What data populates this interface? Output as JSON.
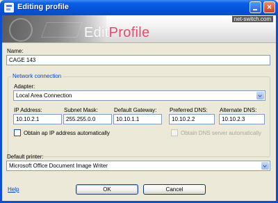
{
  "window": {
    "title": "Editing profile",
    "close_glyph": "×"
  },
  "banner": {
    "title_part1": "Edit",
    "title_part2": "Profile",
    "site": "net-switch.com"
  },
  "form": {
    "name_label": "Name:",
    "name_value": "CAGE 143",
    "network_group_title": "Network connection",
    "adapter_label": "Adapter:",
    "adapter_value": "Local Area Connection",
    "ip_label": "IP Address:",
    "ip_value": "10.10.2.1",
    "mask_label": "Subnet Mask:",
    "mask_value": "255.255.0.0",
    "gateway_label": "Default Gateway:",
    "gateway_value": "10.10.1.1",
    "dns1_label": "Preferred DNS:",
    "dns1_value": "10.10.2.2",
    "dns2_label": "Alternate DNS:",
    "dns2_value": "10.10.2.3",
    "auto_ip_label": "Obtain ap IP address automatically",
    "auto_dns_label": "Obtain DNS server automatically",
    "printer_label": "Default printer:",
    "printer_value": "Microsoft Office Document Image Writer"
  },
  "footer": {
    "help_link": "Help",
    "ok_label": "OK",
    "cancel_label": "Cancel"
  },
  "colors": {
    "titlebar": "#0553d9",
    "group_title": "#0046d5",
    "banner_accent": "#e94a6e"
  }
}
